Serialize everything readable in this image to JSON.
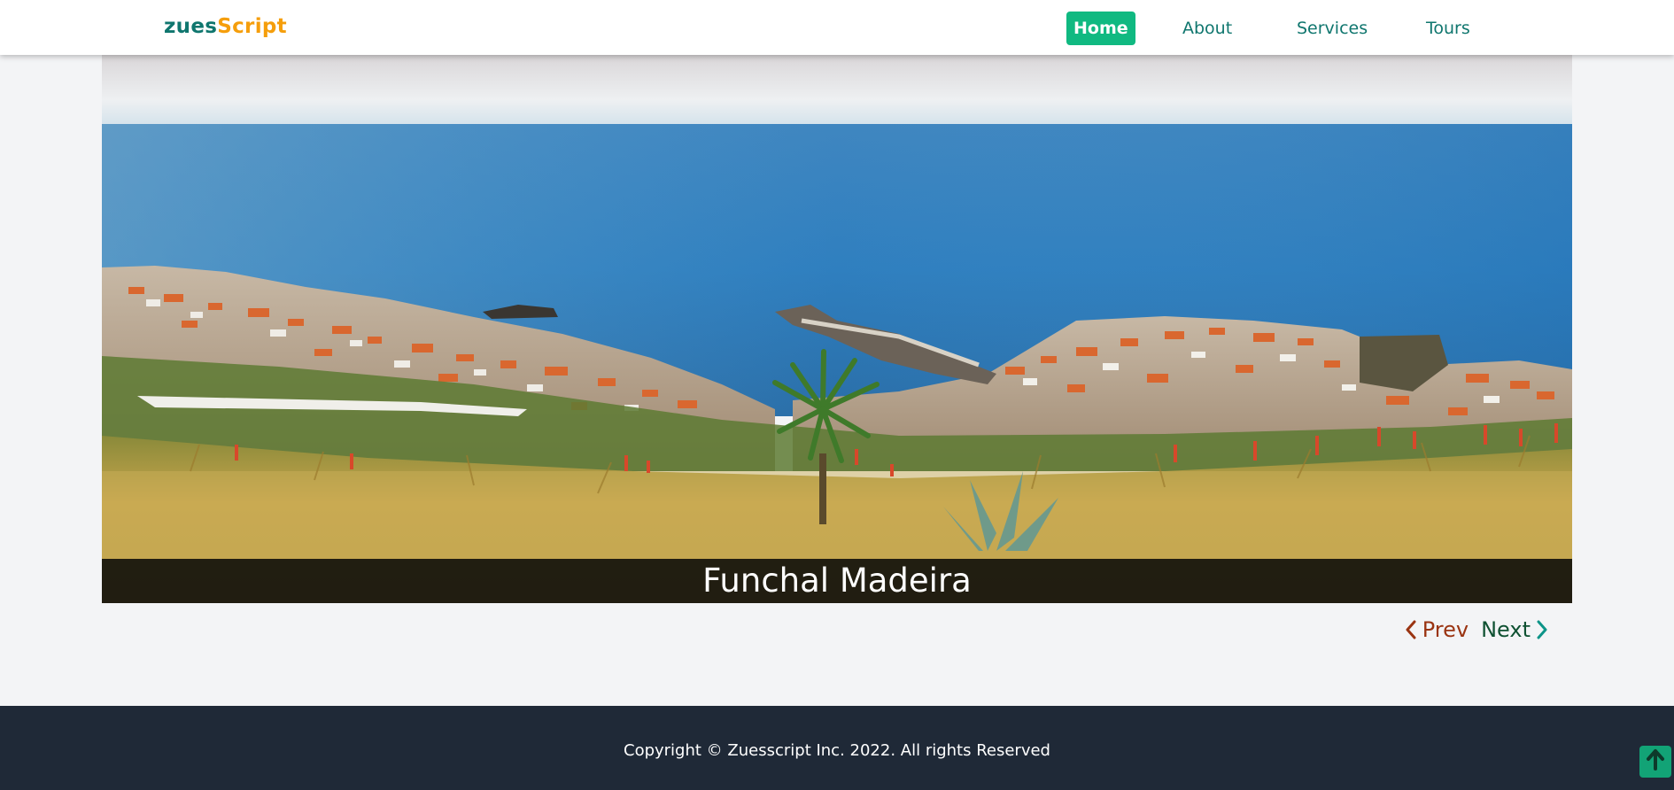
{
  "header": {
    "brand_part1": "zues",
    "brand_part2": "Script",
    "nav": [
      {
        "label": "Home",
        "active": true
      },
      {
        "label": "About",
        "active": false
      },
      {
        "label": "Services",
        "active": false
      },
      {
        "label": "Tours",
        "active": false
      }
    ]
  },
  "slider": {
    "caption": "Funchal Madeira",
    "prev_label": "Prev",
    "next_label": "Next"
  },
  "footer": {
    "copyright": "Copyright © Zuesscript Inc. 2022. All rights Reserved"
  },
  "colors": {
    "brand_primary": "#0f766e",
    "brand_accent": "#f59e0b",
    "active_nav": "#10b981",
    "footer_bg": "#1f2937",
    "prev_color": "#9a3412",
    "next_color": "#0f5132"
  },
  "icons": {
    "prev": "chevron-left-icon",
    "next": "chevron-right-icon",
    "scroll_top": "arrow-up-icon"
  }
}
